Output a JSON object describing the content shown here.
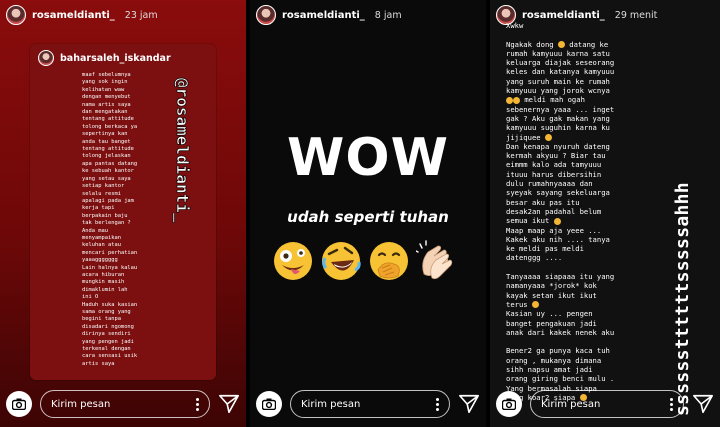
{
  "story1": {
    "username": "rosameldianti_",
    "time": "23 jam",
    "quoted_username": "baharsaleh_iskandar",
    "quoted_text": "maaf sebelumnya\nyang sok ingin\nkelihatan waw\ndengan menyebut\nnama artis saya\ndan mengatakan\ntentang attitude\ntolong berkaca ya\nsepertinya kan\nanda tau banget\ntentang attitude\ntolong jelaskan\napa pantas datang\nke sebuah kantor\nyang setau saya\nsetiap kantor\nselalu resmi\napalagi pada jam\nkerja tapi\nberpakain baju\ntak berlengan ?\nAnda mau\nmenyampaikan\nkeluhan atau\nmencari perhatian\nyaaaggggggg\nLain halnya kalau\nacara hiburan\nmungkin masih\ndimaklumin lah\nini O\nHaduh suka kasian\nsama orang yang\nbegini tanpa\ndisadari ngomong\ndirinya sendiri\nyang pengen jadi\nterkenal dengan\ncara sensasi usik\nartis saya",
    "mention": "@rosameldianti_",
    "message_placeholder": "Kirim pesan"
  },
  "story2": {
    "username": "rosameldianti_",
    "time": "8 jam",
    "headline": "WOW",
    "subtitle": "udah seperti tuhan",
    "emojis": [
      "zany-face-emoji",
      "rolling-laughing-emoji",
      "hand-over-mouth-emoji",
      "clapping-hands-emoji"
    ],
    "message_placeholder": "Kirim pesan"
  },
  "story3": {
    "username": "rosameldianti_",
    "time": "29 menit",
    "text_part1": "Xwkw\n\nNgakak dong",
    "text_part2": " datang ke\nrumah kamyuuu karna satu\nkeluarga diajak seseorang\nkeles dan katanya kamyuuu\nyang suruh main ke rumah\nkamyuuu yang jorok wcnya",
    "text_part3": " meldi mah ogah\nsebenernya yaaa ... inget\ngak ? Aku gak makan yang\nkamyuuu suguhin karna ku\njijiquee",
    "text_part4": "\nDan kenapa nyuruh dateng\nkermah akyuu ? Biar tau\neimmm kalo ada tamyuuu\nituuu harus dibersihin\ndulu rumahnyaaaa dan\nsyeyak sayang sekeluarga\nbesar aku pas itu\ndesak2an padahal belum\nsemua ikut",
    "text_part5": "\nMaap maap aja yeee ...\nKakek aku nih .... tanya\nke meldi pas meldi\ndatenggg ....\n\nTanyaaaa siapaaa itu yang\nnamanyaaa *jorok* kok\nkayak setan ikut ikut\nterus",
    "text_part6": "\nKasian uy ... pengen\nbanget pengakuan jadi\nanak dari kakek nenek aku\n\nBener2 ga punya kaca tuh\norang , mukanya dimana\nsihh napsu amat jadi\norang giring benci mulu .\nYang bermasalah siapa\nyang koar2 siapa",
    "side_text": "ssssssttttttsssssahhh",
    "message_placeholder": "Kirim pesan"
  },
  "colors": {
    "story1_bg": "#7c1010",
    "story2_bg": "#0a0a0a",
    "story3_bg": "#111111"
  }
}
